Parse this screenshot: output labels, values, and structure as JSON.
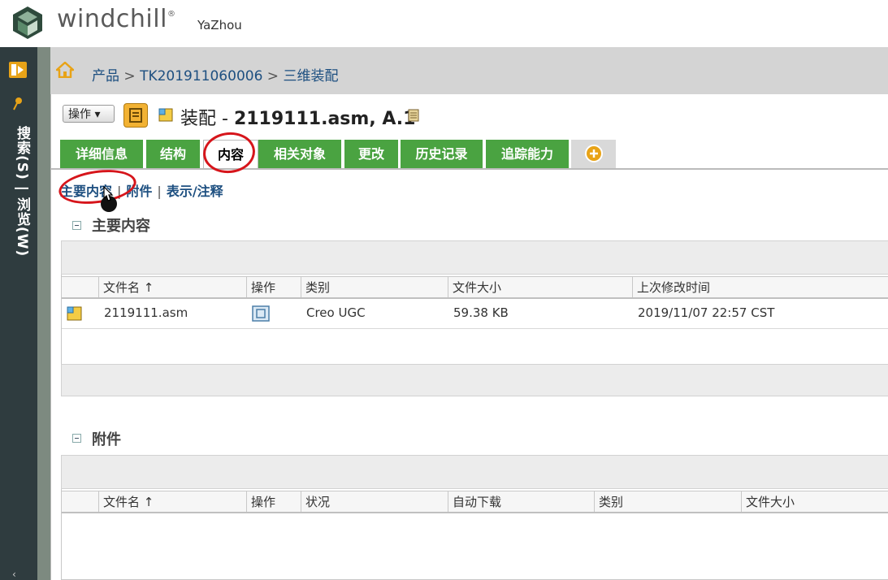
{
  "app": {
    "brand": "windchill",
    "user": "YaZhou"
  },
  "leftrail": {
    "label": "搜索(S) | 浏览(W)"
  },
  "breadcrumb": {
    "items": [
      "产品",
      "TK201911060006",
      "三维装配"
    ],
    "separator": ">"
  },
  "title": {
    "actions_label": "操作 ▾",
    "prefix": "装配 - ",
    "name": "2119111.asm, A.1"
  },
  "tabs": [
    "详细信息",
    "结构",
    "内容",
    "相关对象",
    "更改",
    "历史记录",
    "追踪能力"
  ],
  "active_tab": "内容",
  "subtabs": [
    "主要内容",
    "附件",
    "表示/注释"
  ],
  "primary": {
    "title": "主要内容",
    "columns": [
      "文件名 ↑",
      "操作",
      "类别",
      "文件大小",
      "上次修改时间"
    ],
    "rows": [
      {
        "file": "2119111.asm",
        "category": "Creo UGC",
        "size": "59.38 KB",
        "modified": "2019/11/07 22:57 CST"
      }
    ]
  },
  "attachments": {
    "title": "附件",
    "columns": [
      "文件名 ↑",
      "操作",
      "状况",
      "自动下载",
      "类别",
      "文件大小"
    ]
  },
  "colors": {
    "tab_green": "#4aa341",
    "link_blue": "#1d4f80",
    "annotation_red": "#d6151b",
    "rail": "#2f3c3f"
  }
}
